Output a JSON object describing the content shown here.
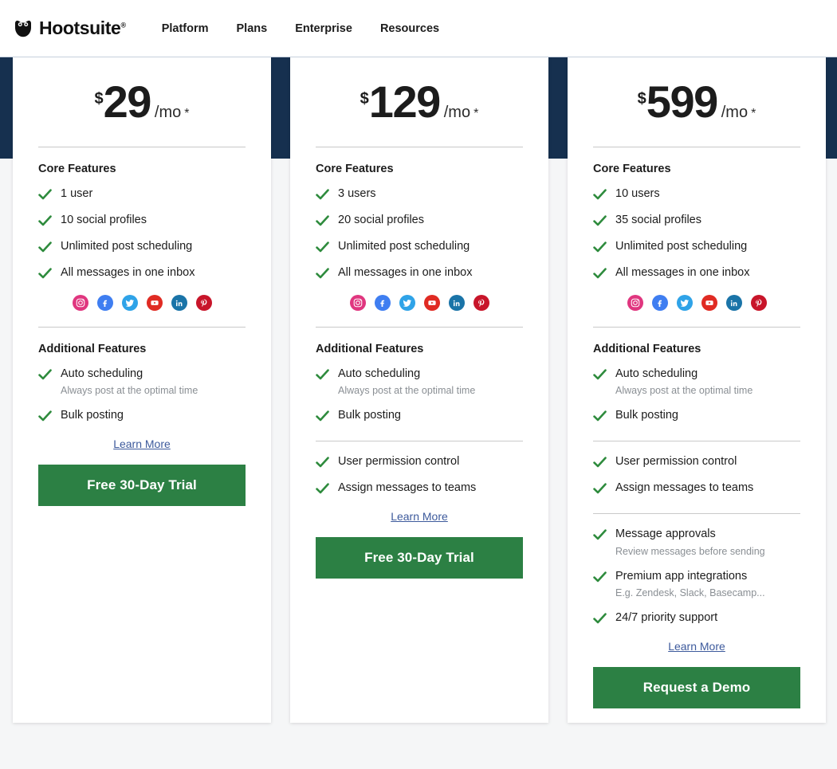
{
  "header": {
    "logo": {
      "icon": "owl-icon",
      "wordmark": "Hootsuite",
      "registered_mark": "®"
    },
    "nav": [
      {
        "label": "Platform"
      },
      {
        "label": "Plans"
      },
      {
        "label": "Enterprise"
      },
      {
        "label": "Resources"
      }
    ]
  },
  "colors": {
    "navy_band": "#16304f",
    "cta_green": "#2c8044",
    "check_green": "#2e8b3d",
    "link_blue": "#3d5a9c",
    "page_bg": "#f5f6f7",
    "sub_text_gray": "#8a8f94"
  },
  "section_labels": {
    "core": "Core Features",
    "additional": "Additional Features"
  },
  "social_icons": [
    {
      "name": "instagram-icon",
      "color": "#e0367f"
    },
    {
      "name": "facebook-icon",
      "color": "#3f7ef1"
    },
    {
      "name": "twitter-icon",
      "color": "#2fa3e8"
    },
    {
      "name": "youtube-icon",
      "color": "#e02b23"
    },
    {
      "name": "linkedin-icon",
      "color": "#1a74a8"
    },
    {
      "name": "pinterest-icon",
      "color": "#c8152a"
    }
  ],
  "plans": [
    {
      "id": "professional",
      "price": {
        "currency": "$",
        "amount": "29",
        "period": "/mo",
        "asterisk": "*"
      },
      "core_features": [
        {
          "text": "1 user"
        },
        {
          "text": "10 social profiles"
        },
        {
          "text": "Unlimited post scheduling"
        },
        {
          "text": "All messages in one inbox"
        }
      ],
      "additional_groups": [
        {
          "items": [
            {
              "text": "Auto scheduling",
              "sub": "Always post at the optimal time"
            },
            {
              "text": "Bulk posting",
              "sub": ""
            }
          ]
        }
      ],
      "learn_more": "Learn More",
      "cta": "Free 30-Day Trial"
    },
    {
      "id": "team",
      "price": {
        "currency": "$",
        "amount": "129",
        "period": "/mo",
        "asterisk": "*"
      },
      "core_features": [
        {
          "text": "3 users"
        },
        {
          "text": "20 social profiles"
        },
        {
          "text": "Unlimited post scheduling"
        },
        {
          "text": "All messages in one inbox"
        }
      ],
      "additional_groups": [
        {
          "items": [
            {
              "text": "Auto scheduling",
              "sub": "Always post at the optimal time"
            },
            {
              "text": "Bulk posting",
              "sub": ""
            }
          ]
        },
        {
          "items": [
            {
              "text": "User permission control",
              "sub": ""
            },
            {
              "text": "Assign messages to teams",
              "sub": ""
            }
          ]
        }
      ],
      "learn_more": "Learn More",
      "cta": "Free 30-Day Trial"
    },
    {
      "id": "business",
      "price": {
        "currency": "$",
        "amount": "599",
        "period": "/mo",
        "asterisk": "*"
      },
      "core_features": [
        {
          "text": "10 users"
        },
        {
          "text": "35 social profiles"
        },
        {
          "text": "Unlimited post scheduling"
        },
        {
          "text": "All messages in one inbox"
        }
      ],
      "additional_groups": [
        {
          "items": [
            {
              "text": "Auto scheduling",
              "sub": "Always post at the optimal time"
            },
            {
              "text": "Bulk posting",
              "sub": ""
            }
          ]
        },
        {
          "items": [
            {
              "text": "User permission control",
              "sub": ""
            },
            {
              "text": "Assign messages to teams",
              "sub": ""
            }
          ]
        },
        {
          "items": [
            {
              "text": "Message approvals",
              "sub": "Review messages before sending"
            },
            {
              "text": "Premium app integrations",
              "sub": "E.g. Zendesk, Slack, Basecamp..."
            },
            {
              "text": "24/7 priority support",
              "sub": ""
            }
          ]
        }
      ],
      "learn_more": "Learn More",
      "cta": "Request a Demo"
    }
  ]
}
